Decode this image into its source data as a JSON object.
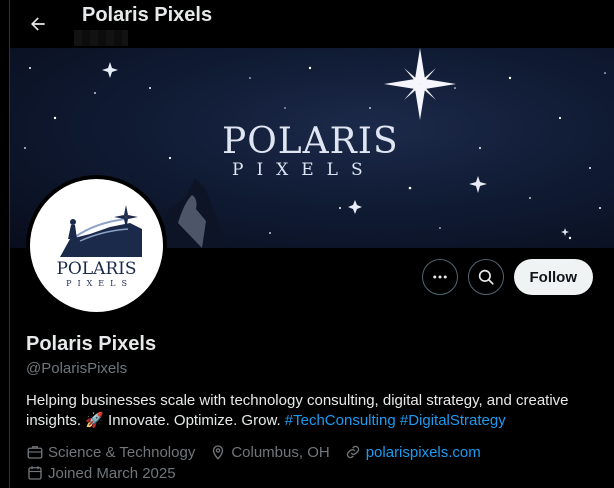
{
  "header": {
    "title": "Polaris Pixels"
  },
  "banner": {
    "word1": "POLARIS",
    "word2": "PIXELS"
  },
  "avatar": {
    "word1": "POLARIS",
    "word2": "PIXELS"
  },
  "actions": {
    "more_icon": "more-icon",
    "search_icon": "search-icon",
    "follow_label": "Follow"
  },
  "profile": {
    "name": "Polaris Pixels",
    "handle": "@PolarisPixels",
    "bio_text": "Helping businesses scale with technology consulting, digital strategy, and creative insights. 🚀 Innovate. Optimize. Grow. ",
    "bio_tags": [
      "#TechConsulting",
      "#DigitalStrategy"
    ],
    "category": "Science & Technology",
    "location": "Columbus, OH",
    "website": "polarispixels.com",
    "joined": "Joined March 2025"
  },
  "colors": {
    "background": "#000000",
    "link": "#1d9bf0",
    "muted": "#71767b",
    "follow_bg": "#eff3f4"
  }
}
